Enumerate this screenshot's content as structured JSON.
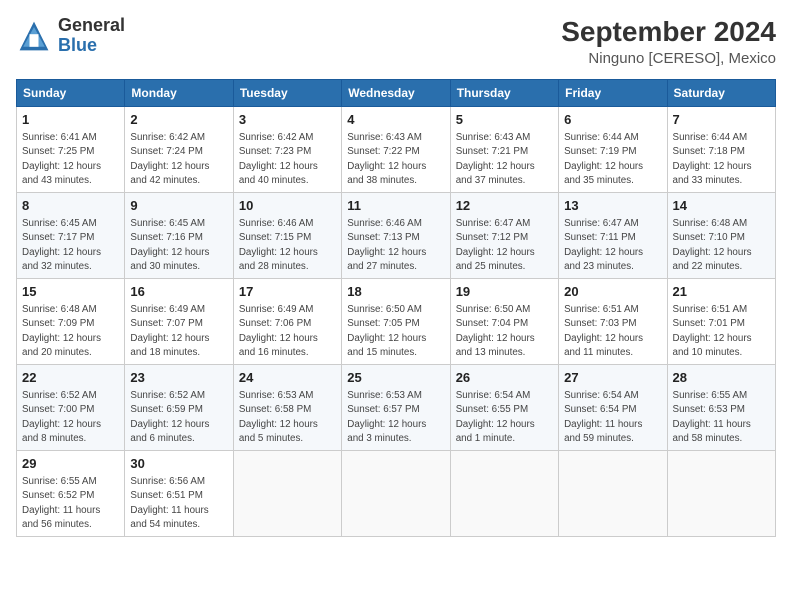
{
  "header": {
    "logo_general": "General",
    "logo_blue": "Blue",
    "month_title": "September 2024",
    "location": "Ninguno [CERESO], Mexico"
  },
  "columns": [
    "Sunday",
    "Monday",
    "Tuesday",
    "Wednesday",
    "Thursday",
    "Friday",
    "Saturday"
  ],
  "weeks": [
    [
      {
        "day": "1",
        "info": "Sunrise: 6:41 AM\nSunset: 7:25 PM\nDaylight: 12 hours\nand 43 minutes."
      },
      {
        "day": "2",
        "info": "Sunrise: 6:42 AM\nSunset: 7:24 PM\nDaylight: 12 hours\nand 42 minutes."
      },
      {
        "day": "3",
        "info": "Sunrise: 6:42 AM\nSunset: 7:23 PM\nDaylight: 12 hours\nand 40 minutes."
      },
      {
        "day": "4",
        "info": "Sunrise: 6:43 AM\nSunset: 7:22 PM\nDaylight: 12 hours\nand 38 minutes."
      },
      {
        "day": "5",
        "info": "Sunrise: 6:43 AM\nSunset: 7:21 PM\nDaylight: 12 hours\nand 37 minutes."
      },
      {
        "day": "6",
        "info": "Sunrise: 6:44 AM\nSunset: 7:19 PM\nDaylight: 12 hours\nand 35 minutes."
      },
      {
        "day": "7",
        "info": "Sunrise: 6:44 AM\nSunset: 7:18 PM\nDaylight: 12 hours\nand 33 minutes."
      }
    ],
    [
      {
        "day": "8",
        "info": "Sunrise: 6:45 AM\nSunset: 7:17 PM\nDaylight: 12 hours\nand 32 minutes."
      },
      {
        "day": "9",
        "info": "Sunrise: 6:45 AM\nSunset: 7:16 PM\nDaylight: 12 hours\nand 30 minutes."
      },
      {
        "day": "10",
        "info": "Sunrise: 6:46 AM\nSunset: 7:15 PM\nDaylight: 12 hours\nand 28 minutes."
      },
      {
        "day": "11",
        "info": "Sunrise: 6:46 AM\nSunset: 7:13 PM\nDaylight: 12 hours\nand 27 minutes."
      },
      {
        "day": "12",
        "info": "Sunrise: 6:47 AM\nSunset: 7:12 PM\nDaylight: 12 hours\nand 25 minutes."
      },
      {
        "day": "13",
        "info": "Sunrise: 6:47 AM\nSunset: 7:11 PM\nDaylight: 12 hours\nand 23 minutes."
      },
      {
        "day": "14",
        "info": "Sunrise: 6:48 AM\nSunset: 7:10 PM\nDaylight: 12 hours\nand 22 minutes."
      }
    ],
    [
      {
        "day": "15",
        "info": "Sunrise: 6:48 AM\nSunset: 7:09 PM\nDaylight: 12 hours\nand 20 minutes."
      },
      {
        "day": "16",
        "info": "Sunrise: 6:49 AM\nSunset: 7:07 PM\nDaylight: 12 hours\nand 18 minutes."
      },
      {
        "day": "17",
        "info": "Sunrise: 6:49 AM\nSunset: 7:06 PM\nDaylight: 12 hours\nand 16 minutes."
      },
      {
        "day": "18",
        "info": "Sunrise: 6:50 AM\nSunset: 7:05 PM\nDaylight: 12 hours\nand 15 minutes."
      },
      {
        "day": "19",
        "info": "Sunrise: 6:50 AM\nSunset: 7:04 PM\nDaylight: 12 hours\nand 13 minutes."
      },
      {
        "day": "20",
        "info": "Sunrise: 6:51 AM\nSunset: 7:03 PM\nDaylight: 12 hours\nand 11 minutes."
      },
      {
        "day": "21",
        "info": "Sunrise: 6:51 AM\nSunset: 7:01 PM\nDaylight: 12 hours\nand 10 minutes."
      }
    ],
    [
      {
        "day": "22",
        "info": "Sunrise: 6:52 AM\nSunset: 7:00 PM\nDaylight: 12 hours\nand 8 minutes."
      },
      {
        "day": "23",
        "info": "Sunrise: 6:52 AM\nSunset: 6:59 PM\nDaylight: 12 hours\nand 6 minutes."
      },
      {
        "day": "24",
        "info": "Sunrise: 6:53 AM\nSunset: 6:58 PM\nDaylight: 12 hours\nand 5 minutes."
      },
      {
        "day": "25",
        "info": "Sunrise: 6:53 AM\nSunset: 6:57 PM\nDaylight: 12 hours\nand 3 minutes."
      },
      {
        "day": "26",
        "info": "Sunrise: 6:54 AM\nSunset: 6:55 PM\nDaylight: 12 hours\nand 1 minute."
      },
      {
        "day": "27",
        "info": "Sunrise: 6:54 AM\nSunset: 6:54 PM\nDaylight: 11 hours\nand 59 minutes."
      },
      {
        "day": "28",
        "info": "Sunrise: 6:55 AM\nSunset: 6:53 PM\nDaylight: 11 hours\nand 58 minutes."
      }
    ],
    [
      {
        "day": "29",
        "info": "Sunrise: 6:55 AM\nSunset: 6:52 PM\nDaylight: 11 hours\nand 56 minutes."
      },
      {
        "day": "30",
        "info": "Sunrise: 6:56 AM\nSunset: 6:51 PM\nDaylight: 11 hours\nand 54 minutes."
      },
      {
        "day": "",
        "info": ""
      },
      {
        "day": "",
        "info": ""
      },
      {
        "day": "",
        "info": ""
      },
      {
        "day": "",
        "info": ""
      },
      {
        "day": "",
        "info": ""
      }
    ]
  ]
}
